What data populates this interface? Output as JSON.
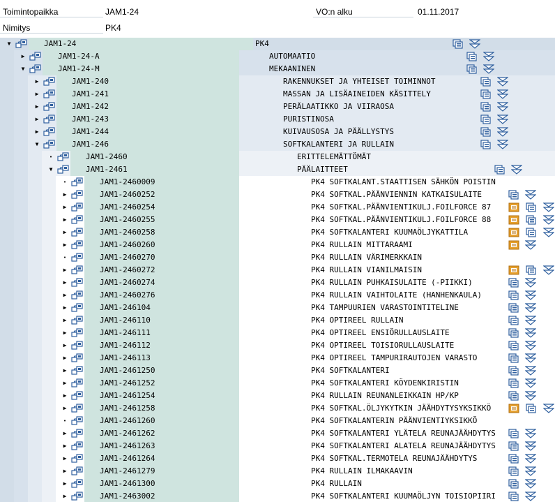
{
  "header": {
    "location_label": "Toimintopaikka",
    "location_value": "JAM1-24",
    "start_label": "VO:n alku",
    "start_value": "01.11.2017",
    "name_label": "Nimitys",
    "name_value": "PK4"
  },
  "tree": [
    {
      "key": "JAM1-24",
      "desc": "PK4",
      "level": 0,
      "toggle": "expanded",
      "actions": [
        "copy-icon",
        "expand-all-icon"
      ]
    },
    {
      "key": "JAM1-24-A",
      "desc": "AUTOMAATIO",
      "level": 1,
      "toggle": "collapsed",
      "actions": [
        "copy-icon",
        "expand-all-icon"
      ]
    },
    {
      "key": "JAM1-24-M",
      "desc": "MEKAANINEN",
      "level": 1,
      "toggle": "expanded",
      "actions": [
        "copy-icon",
        "expand-all-icon"
      ]
    },
    {
      "key": "JAM1-240",
      "desc": "RAKENNUKSET JA YHTEISET TOIMINNOT",
      "level": 2,
      "toggle": "collapsed",
      "actions": [
        "copy-icon",
        "expand-all-icon"
      ]
    },
    {
      "key": "JAM1-241",
      "desc": "MASSAN JA LISÄAINEIDEN KÄSITTELY",
      "level": 2,
      "toggle": "collapsed",
      "actions": [
        "copy-icon",
        "expand-all-icon"
      ]
    },
    {
      "key": "JAM1-242",
      "desc": "PERÄLAATIKKO JA VIIRAOSA",
      "level": 2,
      "toggle": "collapsed",
      "actions": [
        "copy-icon",
        "expand-all-icon"
      ]
    },
    {
      "key": "JAM1-243",
      "desc": "PURISTINOSA",
      "level": 2,
      "toggle": "collapsed",
      "actions": [
        "copy-icon",
        "expand-all-icon"
      ]
    },
    {
      "key": "JAM1-244",
      "desc": "KUIVAUSOSA JA PÄÄLLYSTYS",
      "level": 2,
      "toggle": "collapsed",
      "actions": [
        "copy-icon",
        "expand-all-icon"
      ]
    },
    {
      "key": "JAM1-246",
      "desc": "SOFTKALANTERI JA RULLAIN",
      "level": 2,
      "toggle": "expanded",
      "actions": [
        "copy-icon",
        "expand-all-icon"
      ]
    },
    {
      "key": "JAM1-2460",
      "desc": "ERITTELEMÄTTÖMÄT",
      "level": 3,
      "toggle": "leaf",
      "actions": []
    },
    {
      "key": "JAM1-2461",
      "desc": "PÄÄLAITTEET",
      "level": 3,
      "toggle": "expanded",
      "actions": [
        "copy-icon",
        "expand-all-icon"
      ]
    },
    {
      "key": "JAM1-2460009",
      "desc": "PK4 SOFTKALANT.STAATTISEN SÄHKÖN POISTIN",
      "level": 4,
      "toggle": "leaf",
      "actions": []
    },
    {
      "key": "JAM1-2460252",
      "desc": "PK4 SOFTKAL.PÄÄNVIENNIN KATKAISULAITE",
      "level": 4,
      "toggle": "collapsed",
      "actions": [
        "copy-icon",
        "expand-all-icon"
      ]
    },
    {
      "key": "JAM1-2460254",
      "desc": "PK4 SOFTKAL.PÄÄNVIENTIKULJ.FOILFORCE 87",
      "level": 4,
      "toggle": "collapsed",
      "actions": [
        "document-icon",
        "copy-icon",
        "expand-all-icon"
      ]
    },
    {
      "key": "JAM1-2460255",
      "desc": "PK4 SOFTKAL.PÄÄNVIENTIKULJ.FOILFORCE 88",
      "level": 4,
      "toggle": "collapsed",
      "actions": [
        "document-icon",
        "copy-icon",
        "expand-all-icon"
      ]
    },
    {
      "key": "JAM1-2460258",
      "desc": "PK4 SOFTKALANTERI KUUMAÖLJYKATTILA",
      "level": 4,
      "toggle": "collapsed",
      "actions": [
        "document-icon",
        "copy-icon",
        "expand-all-icon"
      ]
    },
    {
      "key": "JAM1-2460260",
      "desc": "PK4 RULLAIN MITTARAAMI",
      "level": 4,
      "toggle": "collapsed",
      "actions": [
        "document-icon",
        "expand-all-icon"
      ]
    },
    {
      "key": "JAM1-2460270",
      "desc": "PK4 RULLAIN VÄRIMERKKAIN",
      "level": 4,
      "toggle": "leaf",
      "actions": []
    },
    {
      "key": "JAM1-2460272",
      "desc": "PK4 RULLAIN VIANILMAISIN",
      "level": 4,
      "toggle": "collapsed",
      "actions": [
        "document-icon",
        "copy-icon",
        "expand-all-icon"
      ]
    },
    {
      "key": "JAM1-2460274",
      "desc": "PK4 RULLAIN PUHKAISULAITE (-PIIKKI)",
      "level": 4,
      "toggle": "collapsed",
      "actions": [
        "copy-icon",
        "expand-all-icon"
      ]
    },
    {
      "key": "JAM1-2460276",
      "desc": "PK4 RULLAIN VAIHTOLAITE (HANHENKAULA)",
      "level": 4,
      "toggle": "collapsed",
      "actions": [
        "copy-icon",
        "expand-all-icon"
      ]
    },
    {
      "key": "JAM1-246104",
      "desc": "PK4 TAMPUURIEN VARASTOINTITELINE",
      "level": 4,
      "toggle": "collapsed",
      "actions": [
        "copy-icon",
        "expand-all-icon"
      ]
    },
    {
      "key": "JAM1-246110",
      "desc": "PK4 OPTIREEL RULLAIN",
      "level": 4,
      "toggle": "collapsed",
      "actions": [
        "copy-icon",
        "expand-all-icon"
      ]
    },
    {
      "key": "JAM1-246111",
      "desc": "PK4 OPTIREEL ENSIÖRULLAUSLAITE",
      "level": 4,
      "toggle": "collapsed",
      "actions": [
        "copy-icon",
        "expand-all-icon"
      ]
    },
    {
      "key": "JAM1-246112",
      "desc": "PK4 OPTIREEL TOISIORULLAUSLAITE",
      "level": 4,
      "toggle": "collapsed",
      "actions": [
        "copy-icon",
        "expand-all-icon"
      ]
    },
    {
      "key": "JAM1-246113",
      "desc": "PK4 OPTIREEL TAMPURIRAUTOJEN VARASTO",
      "level": 4,
      "toggle": "collapsed",
      "actions": [
        "copy-icon",
        "expand-all-icon"
      ]
    },
    {
      "key": "JAM1-2461250",
      "desc": "PK4 SOFTKALANTERI",
      "level": 4,
      "toggle": "collapsed",
      "actions": [
        "copy-icon",
        "expand-all-icon"
      ]
    },
    {
      "key": "JAM1-2461252",
      "desc": "PK4 SOFTKALANTERI KÖYDENKIRISTIN",
      "level": 4,
      "toggle": "collapsed",
      "actions": [
        "copy-icon",
        "expand-all-icon"
      ]
    },
    {
      "key": "JAM1-2461254",
      "desc": "PK4 RULLAIN REUNANLEIKKAIN HP/KP",
      "level": 4,
      "toggle": "collapsed",
      "actions": [
        "copy-icon",
        "expand-all-icon"
      ]
    },
    {
      "key": "JAM1-2461258",
      "desc": "PK4 SOFTKAL.ÖLJYKYTKIN JÄÄHDYTYSYKSIKKÖ",
      "level": 4,
      "toggle": "collapsed",
      "actions": [
        "document-icon",
        "copy-icon",
        "expand-all-icon"
      ]
    },
    {
      "key": "JAM1-2461260",
      "desc": "PK4 SOFTKALANTERIN PÄÄNVIENTIYKSIKKÖ",
      "level": 4,
      "toggle": "leaf",
      "actions": []
    },
    {
      "key": "JAM1-2461262",
      "desc": "PK4 SOFTKALANTERI YLÄTELA REUNAJÄÄHDYTYS",
      "level": 4,
      "toggle": "collapsed",
      "actions": [
        "copy-icon",
        "expand-all-icon"
      ]
    },
    {
      "key": "JAM1-2461263",
      "desc": "PK4 SOFTKALANTERI ALATELA REUNAJÄÄHDYTYS",
      "level": 4,
      "toggle": "collapsed",
      "actions": [
        "copy-icon",
        "expand-all-icon"
      ]
    },
    {
      "key": "JAM1-2461264",
      "desc": "PK4 SOFTKAL.TERMOTELA REUNAJÄÄHDYTYS",
      "level": 4,
      "toggle": "collapsed",
      "actions": [
        "copy-icon",
        "expand-all-icon"
      ]
    },
    {
      "key": "JAM1-2461279",
      "desc": "PK4 RULLAIN ILMAKAAVIN",
      "level": 4,
      "toggle": "collapsed",
      "actions": [
        "copy-icon",
        "expand-all-icon"
      ]
    },
    {
      "key": "JAM1-2461300",
      "desc": "PK4 RULLAIN",
      "level": 4,
      "toggle": "collapsed",
      "actions": [
        "copy-icon",
        "expand-all-icon"
      ]
    },
    {
      "key": "JAM1-2463002",
      "desc": "PK4 SOFTKALANTERI KUUMAÖLJYN TOISIOPIIRI",
      "level": 4,
      "toggle": "collapsed",
      "actions": [
        "copy-icon",
        "expand-all-icon"
      ]
    }
  ],
  "colors": {
    "level_bg": [
      "#d2dde8",
      "#d7e1ec",
      "#e3eaf2",
      "#edf1f6",
      "#ffffff"
    ],
    "key_col": "#cfe4df",
    "icon_blue": "#2f5f9e",
    "icon_orange": "#e6a02e"
  }
}
